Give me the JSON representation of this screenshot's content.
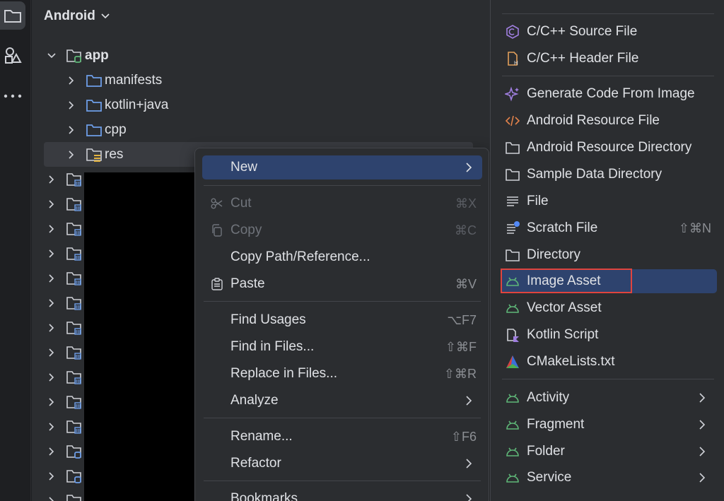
{
  "panel": {
    "title": "Android",
    "tree": [
      {
        "label": "app",
        "bold": true
      },
      {
        "label": "manifests"
      },
      {
        "label": "kotlin+java"
      },
      {
        "label": "cpp"
      },
      {
        "label": "res"
      }
    ]
  },
  "context_menu": {
    "items": [
      {
        "label": "New",
        "shortcut": "",
        "submenu": true,
        "highlighted": true
      },
      {
        "label": "Cut",
        "shortcut": "⌘X",
        "disabled": true,
        "icon": "scissors-icon"
      },
      {
        "label": "Copy",
        "shortcut": "⌘C",
        "disabled": true,
        "icon": "copy-icon"
      },
      {
        "label": "Copy Path/Reference...",
        "shortcut": ""
      },
      {
        "label": "Paste",
        "shortcut": "⌘V",
        "icon": "clipboard-icon"
      },
      {
        "label": "Find Usages",
        "shortcut": "⌥F7"
      },
      {
        "label": "Find in Files...",
        "shortcut": "⇧⌘F"
      },
      {
        "label": "Replace in Files...",
        "shortcut": "⇧⌘R"
      },
      {
        "label": "Analyze",
        "submenu": true
      },
      {
        "label": "Rename...",
        "shortcut": "⇧F6"
      },
      {
        "label": "Refactor",
        "submenu": true
      },
      {
        "label": "Bookmarks",
        "submenu": true
      }
    ]
  },
  "new_submenu": {
    "items": [
      {
        "label": "C/C++ Source File",
        "icon": "cpp-source-icon"
      },
      {
        "label": "C/C++ Header File",
        "icon": "cpp-header-icon"
      },
      {
        "label": "Generate Code From Image",
        "icon": "sparkle-icon"
      },
      {
        "label": "Android Resource File",
        "icon": "code-tag-icon"
      },
      {
        "label": "Android Resource Directory",
        "icon": "folder-icon"
      },
      {
        "label": "Sample Data Directory",
        "icon": "folder-icon"
      },
      {
        "label": "File",
        "icon": "file-lines-icon"
      },
      {
        "label": "Scratch File",
        "icon": "scratch-file-icon",
        "shortcut": "⇧⌘N"
      },
      {
        "label": "Directory",
        "icon": "folder-icon"
      },
      {
        "label": "Image Asset",
        "icon": "android-icon",
        "highlighted": true
      },
      {
        "label": "Vector Asset",
        "icon": "android-icon"
      },
      {
        "label": "Kotlin Script",
        "icon": "kotlin-script-icon"
      },
      {
        "label": "CMakeLists.txt",
        "icon": "cmake-icon"
      },
      {
        "label": "Activity",
        "icon": "android-icon",
        "submenu": true
      },
      {
        "label": "Fragment",
        "icon": "android-icon",
        "submenu": true
      },
      {
        "label": "Folder",
        "icon": "android-icon",
        "submenu": true
      },
      {
        "label": "Service",
        "icon": "android-icon",
        "submenu": true
      }
    ]
  },
  "colors": {
    "accent": "#2e436e",
    "highlight_border": "#e0443e",
    "android_green": "#5fb878",
    "folder_blue": "#6e9ee8"
  }
}
